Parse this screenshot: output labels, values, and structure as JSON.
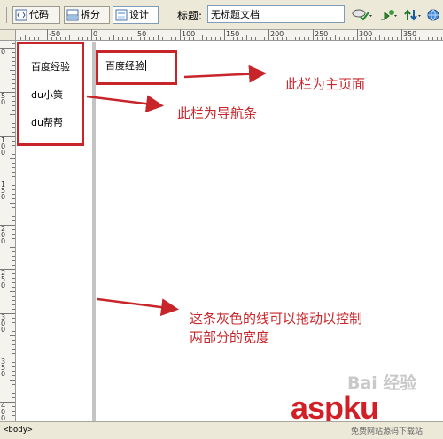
{
  "toolbar": {
    "code_label": "代码",
    "split_label": "拆分",
    "design_label": "设计",
    "title_label": "标题:",
    "title_value": "无标题文档"
  },
  "ruler": {
    "horizontal": [
      "-50",
      "0",
      "50",
      "100",
      "150",
      "200",
      "250",
      "300",
      "350"
    ],
    "vertical": [
      "0",
      "50",
      "100",
      "150",
      "200",
      "250",
      "300",
      "350",
      "400"
    ]
  },
  "nav": {
    "items": [
      "百度经验",
      "du小策",
      "du帮帮"
    ]
  },
  "main": {
    "text": "百度经验"
  },
  "annotations": {
    "main_note": "此栏为主页面",
    "nav_note": "此栏为导航条",
    "divider_note_line1": "这条灰色的线可以拖动以控制",
    "divider_note_line2": "两部分的宽度"
  },
  "status": {
    "tag": "<body>"
  },
  "watermark": {
    "baidu": "Bai 经验",
    "asp": "aspku",
    "sub": "免费网站源码下载站"
  },
  "colors": {
    "annotation_red": "#c8252a",
    "divider_gray": "#c4c4c4",
    "toolbar_bg": "#ece9d8"
  }
}
